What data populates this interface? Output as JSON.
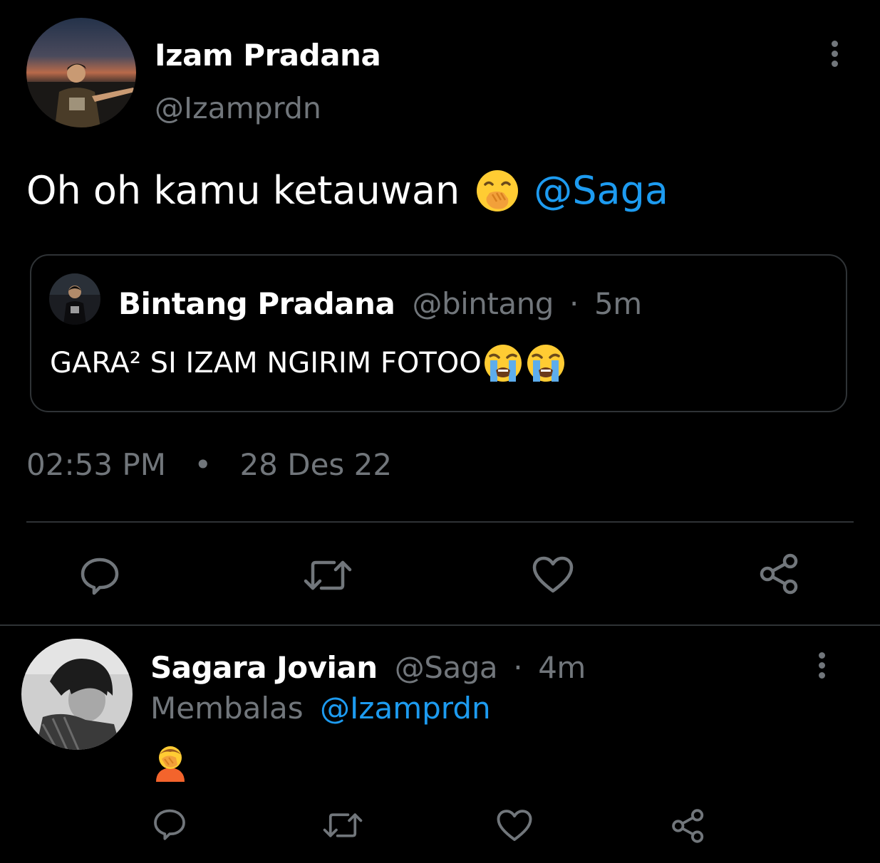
{
  "main_tweet": {
    "author_name": "Izam Pradana",
    "author_handle": "@Izamprdn",
    "text": "Oh oh kamu ketauwan",
    "emoji": "face-with-hand-over-mouth",
    "mention": "@Saga",
    "timestamp_time": "02:53 PM",
    "timestamp_sep": "•",
    "timestamp_date": "28 Des 22"
  },
  "quoted_tweet": {
    "author_name": "Bintang Pradana",
    "author_handle": "@bintang",
    "sep": "·",
    "time_ago": "5m",
    "text": "GARA² SI IZAM NGIRIM FOTOO",
    "emojis": [
      "loudly-crying-face",
      "loudly-crying-face"
    ]
  },
  "reply_tweet": {
    "author_name": "Sagara Jovian",
    "author_handle": "@Saga",
    "sep": "·",
    "time_ago": "4m",
    "replying_label": "Membalas",
    "replying_handle": "@Izamprdn",
    "emoji": "person-facepalming"
  },
  "actions": [
    "reply-icon",
    "retweet-icon",
    "like-icon",
    "share-icon"
  ],
  "colors": {
    "background": "#000000",
    "text": "#ffffff",
    "secondary": "#71767b",
    "accent": "#1d9bf0",
    "border": "#2f3336"
  }
}
